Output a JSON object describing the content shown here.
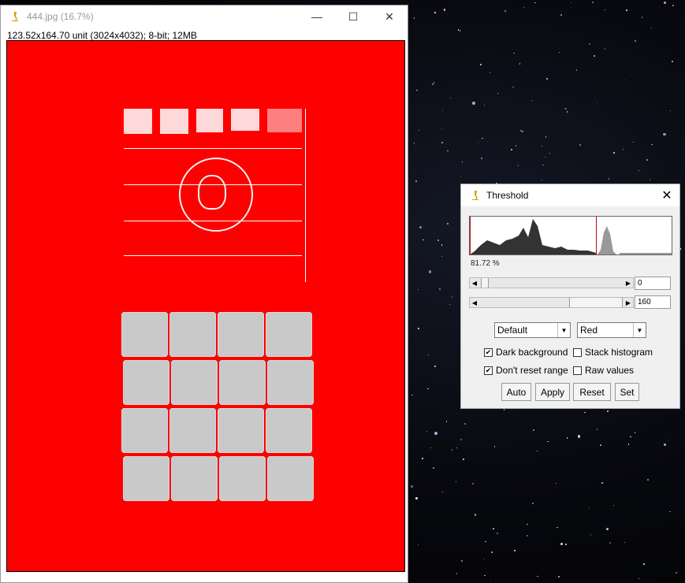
{
  "image_window": {
    "title": "444.jpg (16.7%)",
    "info": "123.52x164.70 unit (3024x4032); 8-bit; 12MB",
    "buttons": {
      "minimize": "—",
      "maximize": "☐",
      "close": "✕"
    }
  },
  "threshold_dialog": {
    "title": "Threshold",
    "percent": "81.72 %",
    "min_value": "0",
    "max_value": "160",
    "method": "Default",
    "display_mode": "Red",
    "checkboxes": [
      {
        "label": "Dark background",
        "checked": true
      },
      {
        "label": "Stack histogram",
        "checked": false
      },
      {
        "label": "Don't reset range",
        "checked": true
      },
      {
        "label": "Raw values",
        "checked": false
      }
    ],
    "buttons": [
      "Auto",
      "Apply",
      "Reset",
      "Set"
    ]
  },
  "colors": {
    "threshold_overlay": "#ff0000",
    "selection_outline": "#d00000"
  }
}
